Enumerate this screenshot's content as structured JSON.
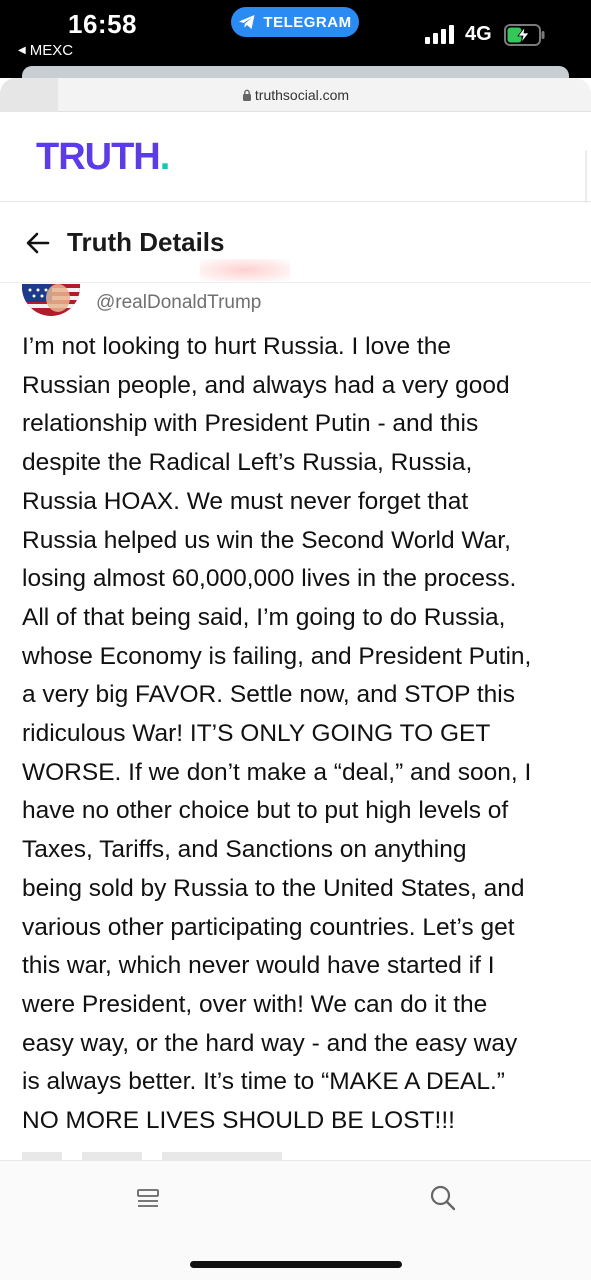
{
  "status_bar": {
    "time": "16:58",
    "back_app": "MEXC",
    "pill_label": "TELEGRAM",
    "network": "4G",
    "pill_color": "#2a8bf2"
  },
  "browser": {
    "url": "truthsocial.com"
  },
  "brand": {
    "logo_text": "TRUTH",
    "logo_dot": ".",
    "logo_color": "#5b3ce6",
    "dot_color": "#17c5b5"
  },
  "header": {
    "title": "Truth Details"
  },
  "post": {
    "handle": "@realDonaldTrump",
    "lines": [
      "I’m not looking to hurt Russia. I love the",
      "Russian people, and always had a very good",
      "relationship with President Putin - and this",
      "despite the Radical Left’s Russia, Russia,",
      "Russia HOAX. We must never forget that",
      "Russia helped us win the Second World War,",
      "losing almost 60,000,000 lives in the process.",
      "All of that being said, I’m going to do Russia,",
      "whose Economy is failing, and President Putin,",
      "a very big FAVOR. Settle now, and STOP this",
      "ridiculous War! IT’S ONLY GOING TO GET",
      "WORSE. If we don’t make a “deal,” and soon, I",
      "have no other choice but to put high levels of",
      "Taxes, Tariffs, and Sanctions on anything",
      "being sold by Russia to the United States, and",
      "various other participating countries. Let’s get",
      "this war, which never would have started if I",
      "were President, over with! We can do it the",
      "easy way, or the hard way - and the easy way",
      "is always better. It’s time to “MAKE A DEAL.”",
      "NO MORE LIVES SHOULD BE LOST!!!"
    ]
  },
  "icons": {
    "back": "arrow-left-icon",
    "lock": "lock-icon",
    "menu": "menu-icon",
    "search": "search-icon",
    "telegram": "telegram-icon",
    "battery": "battery-charging-icon",
    "signal": "cellular-signal-icon"
  }
}
